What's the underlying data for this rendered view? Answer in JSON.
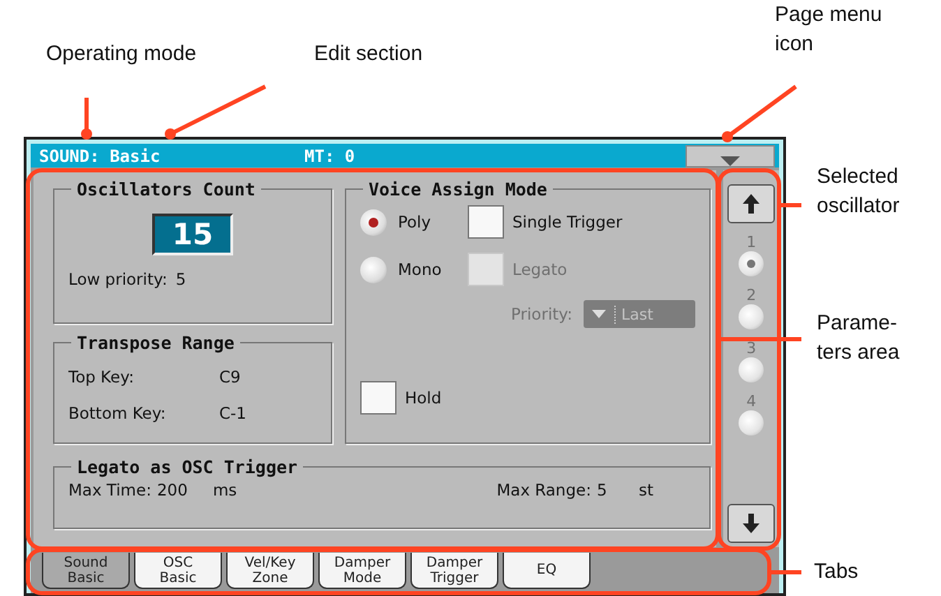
{
  "callouts": [
    {
      "lines": [
        "Operating mode"
      ]
    },
    {
      "lines": [
        "Edit section"
      ]
    },
    {
      "lines": [
        "Page menu",
        "icon"
      ]
    },
    {
      "lines": [
        "Selected",
        "oscillator"
      ]
    },
    {
      "lines": [
        "Parame-",
        "ters area"
      ]
    },
    {
      "lines": [
        "Tabs"
      ]
    }
  ],
  "header": {
    "mode": "SOUND: Basic",
    "mt": "MT: 0"
  },
  "oscillators_count": {
    "title": "Oscillators Count",
    "value": "15",
    "low_priority_label": "Low priority:",
    "low_priority_value": "5"
  },
  "transpose_range": {
    "title": "Transpose Range",
    "rows": [
      {
        "label": "Top Key:",
        "value": "C9"
      },
      {
        "label": "Bottom Key:",
        "value": "C-1"
      }
    ]
  },
  "voice_assign_mode": {
    "title": "Voice Assign Mode",
    "radios": [
      {
        "label": "Poly",
        "selected": true
      },
      {
        "label": "Mono",
        "selected": false
      }
    ],
    "checkboxes": [
      {
        "label": "Single Trigger",
        "checked": false,
        "disabled": false
      },
      {
        "label": "Legato",
        "checked": false,
        "disabled": true
      }
    ],
    "priority": {
      "label": "Priority:",
      "value": "Last",
      "disabled": true
    },
    "hold": {
      "label": "Hold",
      "checked": false
    }
  },
  "legato_trigger": {
    "title": "Legato as OSC Trigger",
    "max_time_label": "Max Time:",
    "max_time_value": "200",
    "max_time_unit": "ms",
    "max_range_label": "Max Range:",
    "max_range_value": "5",
    "max_range_unit": "st"
  },
  "oscillators": [
    {
      "label": "1",
      "selected": true
    },
    {
      "label": "2",
      "selected": false
    },
    {
      "label": "3",
      "selected": false
    },
    {
      "label": "4",
      "selected": false
    }
  ],
  "tabs": [
    {
      "lines": [
        "Sound",
        "Basic"
      ],
      "selected": true
    },
    {
      "lines": [
        "OSC",
        "Basic"
      ],
      "selected": false
    },
    {
      "lines": [
        "Vel/Key",
        "Zone"
      ],
      "selected": false
    },
    {
      "lines": [
        "Damper",
        "Mode"
      ],
      "selected": false
    },
    {
      "lines": [
        "Damper",
        "Trigger"
      ],
      "selected": false
    },
    {
      "lines": [
        "EQ"
      ],
      "selected": false
    }
  ]
}
